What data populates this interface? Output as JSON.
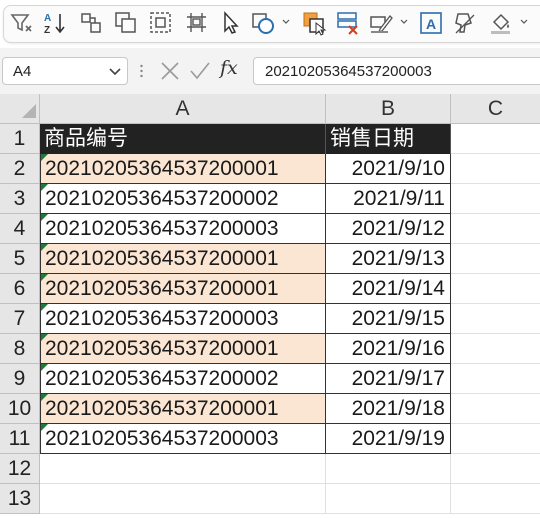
{
  "ribbon": {
    "icons": [
      "filter-icon",
      "sort-icon",
      "group-icon",
      "ungroup-icon",
      "select-objects-icon",
      "selection-pane-icon",
      "pointer-icon",
      "shapes-icon",
      "bring-forward-icon",
      "send-backward-icon",
      "edit-shape-icon",
      "textbox-icon",
      "format-painter-icon",
      "fill-color-icon"
    ]
  },
  "formula_bar": {
    "name_box": "A4",
    "fx_label": "fx",
    "formula": "20210205364537200003"
  },
  "columns": [
    "A",
    "B",
    "C"
  ],
  "rows": [
    {
      "num": "1",
      "a": "商品编号",
      "b": "销售日期",
      "header": true
    },
    {
      "num": "2",
      "a": "20210205364537200001",
      "b": "2021/9/10",
      "highlight": true,
      "tri": true
    },
    {
      "num": "3",
      "a": "20210205364537200002",
      "b": "2021/9/11",
      "highlight": false,
      "tri": true
    },
    {
      "num": "4",
      "a": "20210205364537200003",
      "b": "2021/9/12",
      "highlight": false,
      "tri": true
    },
    {
      "num": "5",
      "a": "20210205364537200001",
      "b": "2021/9/13",
      "highlight": true,
      "tri": true
    },
    {
      "num": "6",
      "a": "20210205364537200001",
      "b": "2021/9/14",
      "highlight": true,
      "tri": true
    },
    {
      "num": "7",
      "a": "20210205364537200003",
      "b": "2021/9/15",
      "highlight": false,
      "tri": true
    },
    {
      "num": "8",
      "a": "20210205364537200001",
      "b": "2021/9/16",
      "highlight": true,
      "tri": true
    },
    {
      "num": "9",
      "a": "20210205364537200002",
      "b": "2021/9/17",
      "highlight": false,
      "tri": true
    },
    {
      "num": "10",
      "a": "20210205364537200001",
      "b": "2021/9/18",
      "highlight": true,
      "tri": true
    },
    {
      "num": "11",
      "a": "20210205364537200003",
      "b": "2021/9/19",
      "highlight": false,
      "tri": true
    },
    {
      "num": "12",
      "a": "",
      "b": ""
    },
    {
      "num": "13",
      "a": "",
      "b": ""
    }
  ],
  "colors": {
    "duplicate_highlight": "#fbe5d3",
    "header_fill": "#222222",
    "header_text": "#ffffff",
    "error_triangle": "#1f7a3a"
  }
}
